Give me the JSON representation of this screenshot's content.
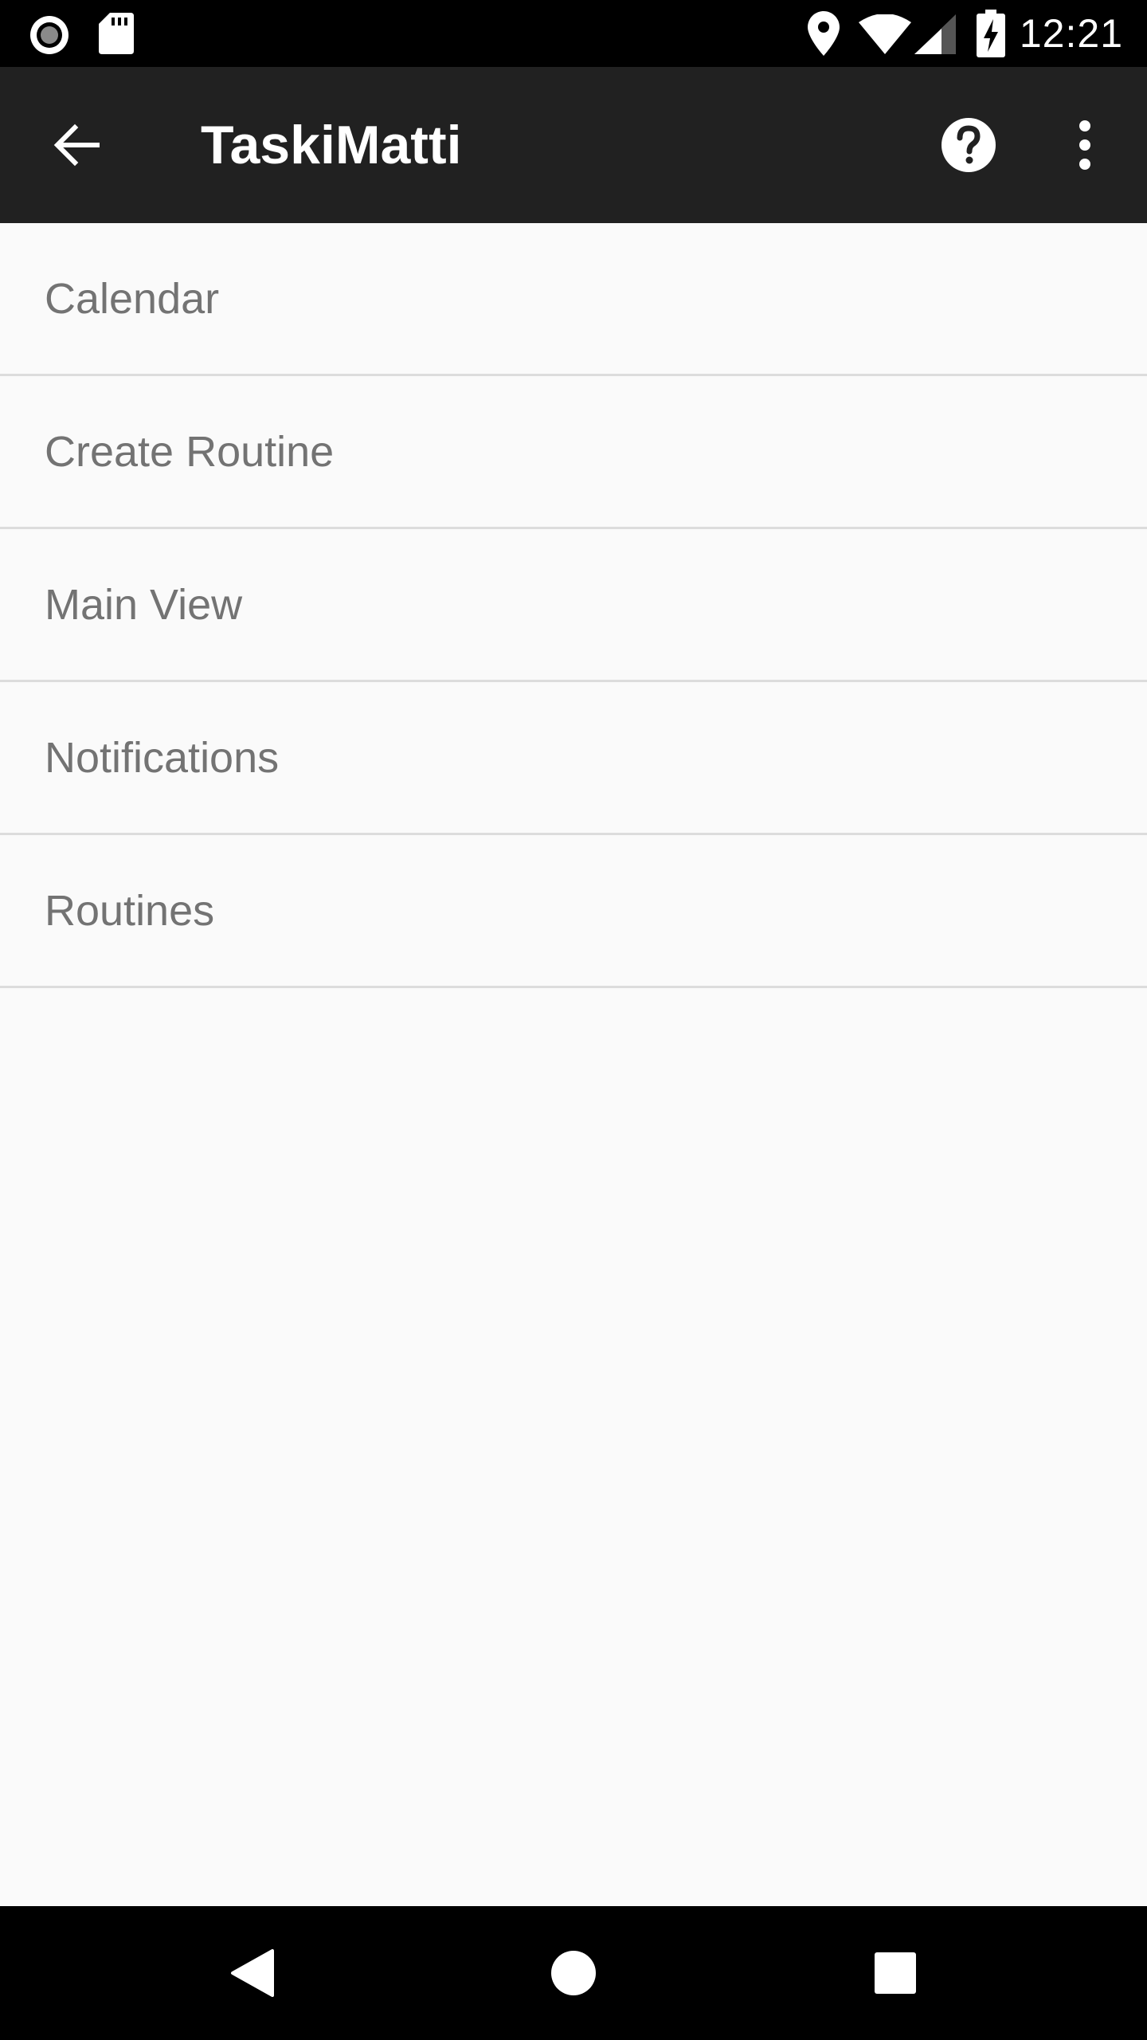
{
  "status_bar": {
    "time": "12:21",
    "icons": [
      "record-icon",
      "sd-card-icon",
      "location-icon",
      "wifi-icon",
      "signal-icon",
      "battery-charging-icon"
    ]
  },
  "app_bar": {
    "title": "TaskiMatti",
    "icons": [
      "back-arrow-icon",
      "help-icon",
      "more-vert-icon"
    ]
  },
  "menu": {
    "items": [
      {
        "label": "Calendar"
      },
      {
        "label": "Create Routine"
      },
      {
        "label": "Main View"
      },
      {
        "label": "Notifications"
      },
      {
        "label": "Routines"
      }
    ]
  },
  "nav_bar": {
    "icons": [
      "nav-back-icon",
      "nav-home-icon",
      "nav-recents-icon"
    ]
  },
  "colors": {
    "status_bar": "#000000",
    "app_bar": "#212121",
    "background": "#fafafa",
    "item_text": "#737373",
    "divider": "#dcdcdc"
  }
}
